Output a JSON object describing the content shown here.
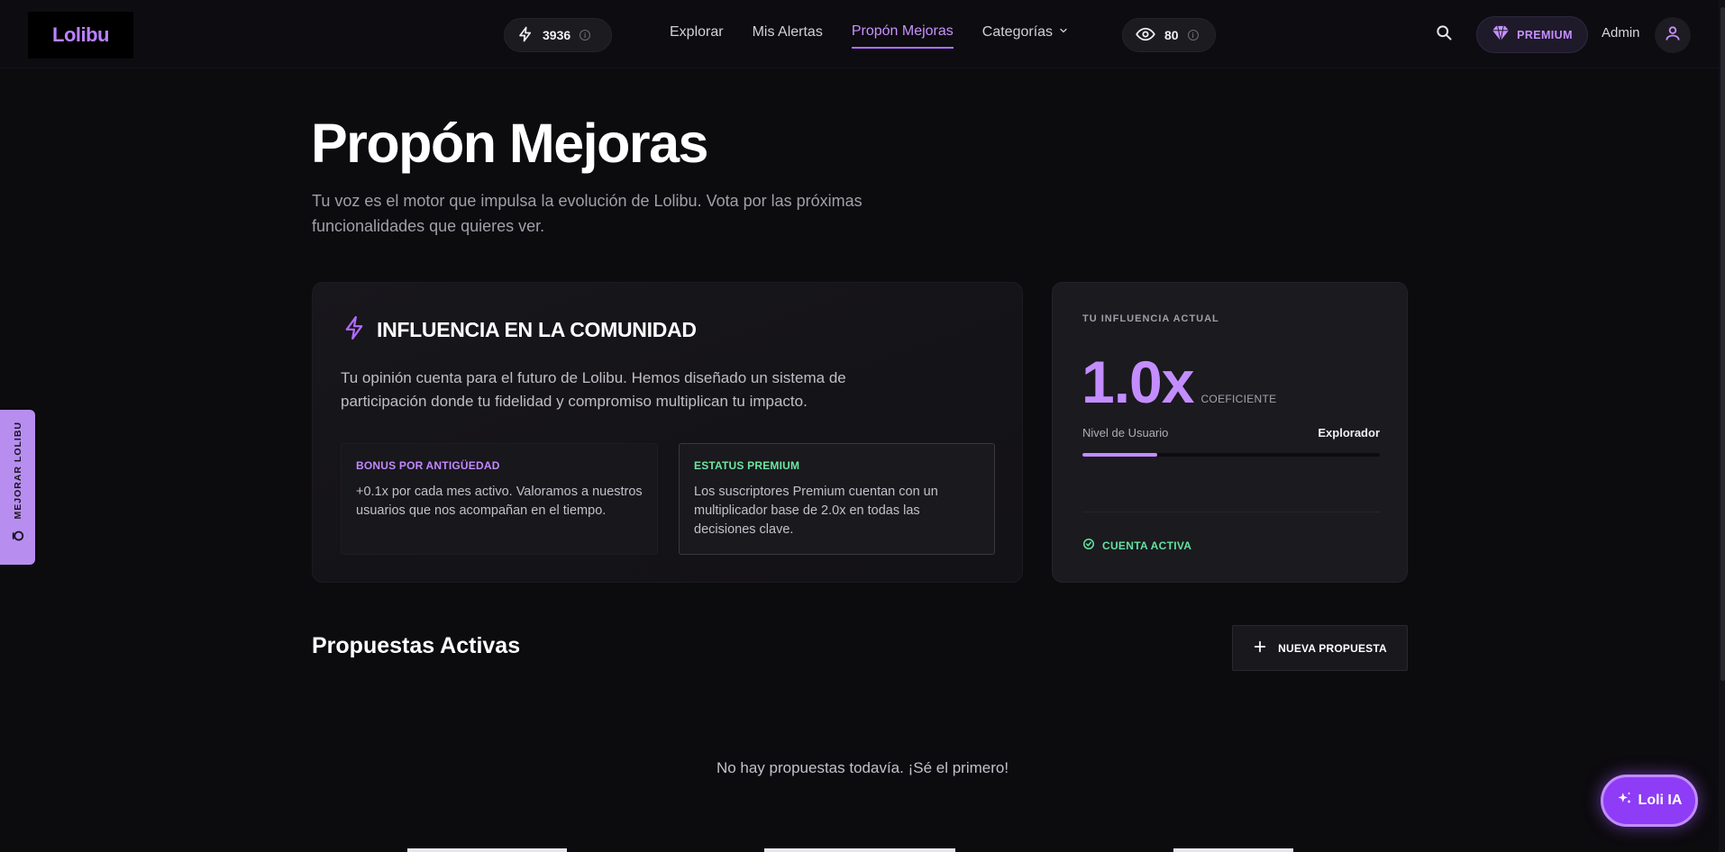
{
  "app": {
    "logo": "Lolibu"
  },
  "topbar": {
    "points_value": "3936",
    "views_value": "80",
    "nav": [
      {
        "label": "Explorar",
        "active": false
      },
      {
        "label": "Mis Alertas",
        "active": false
      },
      {
        "label": "Propón Mejoras",
        "active": true
      },
      {
        "label": "Categorías",
        "active": false
      }
    ],
    "premium_label": "PREMIUM",
    "user_label": "Admin",
    "icons": {
      "points": "lightning-icon",
      "views": "eye-icon",
      "info": "info-icon",
      "search": "search-icon",
      "premium": "diamond-icon",
      "avatar": "user-icon",
      "dropdown": "chevron-down-icon"
    }
  },
  "side_tab": {
    "label": "MEJORAR LOLIBU"
  },
  "header": {
    "title": "Propón Mejoras",
    "subtitle": "Tu voz es el motor que impulsa la evolución de Lolibu. Vota por las próximas funcionalidades que quieres ver."
  },
  "influence_card": {
    "title": "INFLUENCIA EN LA COMUNIDAD",
    "description": "Tu opinión cuenta para el futuro de Lolibu. Hemos diseñado un sistema de participación donde tu fidelidad y compromiso multiplican tu impacto.",
    "boxes": [
      {
        "title": "BONUS POR ANTIGÜEDAD",
        "text": "+0.1x por cada mes activo. Valoramos a nuestros usuarios que nos acompañan en el tiempo."
      },
      {
        "title": "ESTATUS PREMIUM",
        "text": "Los suscriptores Premium cuentan con un multiplicador base de 2.0x en todas las decisiones clave."
      }
    ]
  },
  "current_influence": {
    "label": "TU INFLUENCIA ACTUAL",
    "value": "1.0x",
    "unit": "COEFICIENTE",
    "level_label": "Nivel de Usuario",
    "level_value": "Explorador",
    "level_progress": 0.25,
    "status": "CUENTA ACTIVA"
  },
  "proposals": {
    "title": "Propuestas Activas",
    "new_button": "NUEVA PROPUESTA",
    "empty_text": "No hay propuestas todavía. ¡Sé el primero!"
  },
  "assistant": {
    "label": "Loli IA"
  },
  "colors": {
    "accent": "#c48dff",
    "success": "#63e3a0",
    "background": "#0c0b0e",
    "card": "#1b1a1f"
  }
}
